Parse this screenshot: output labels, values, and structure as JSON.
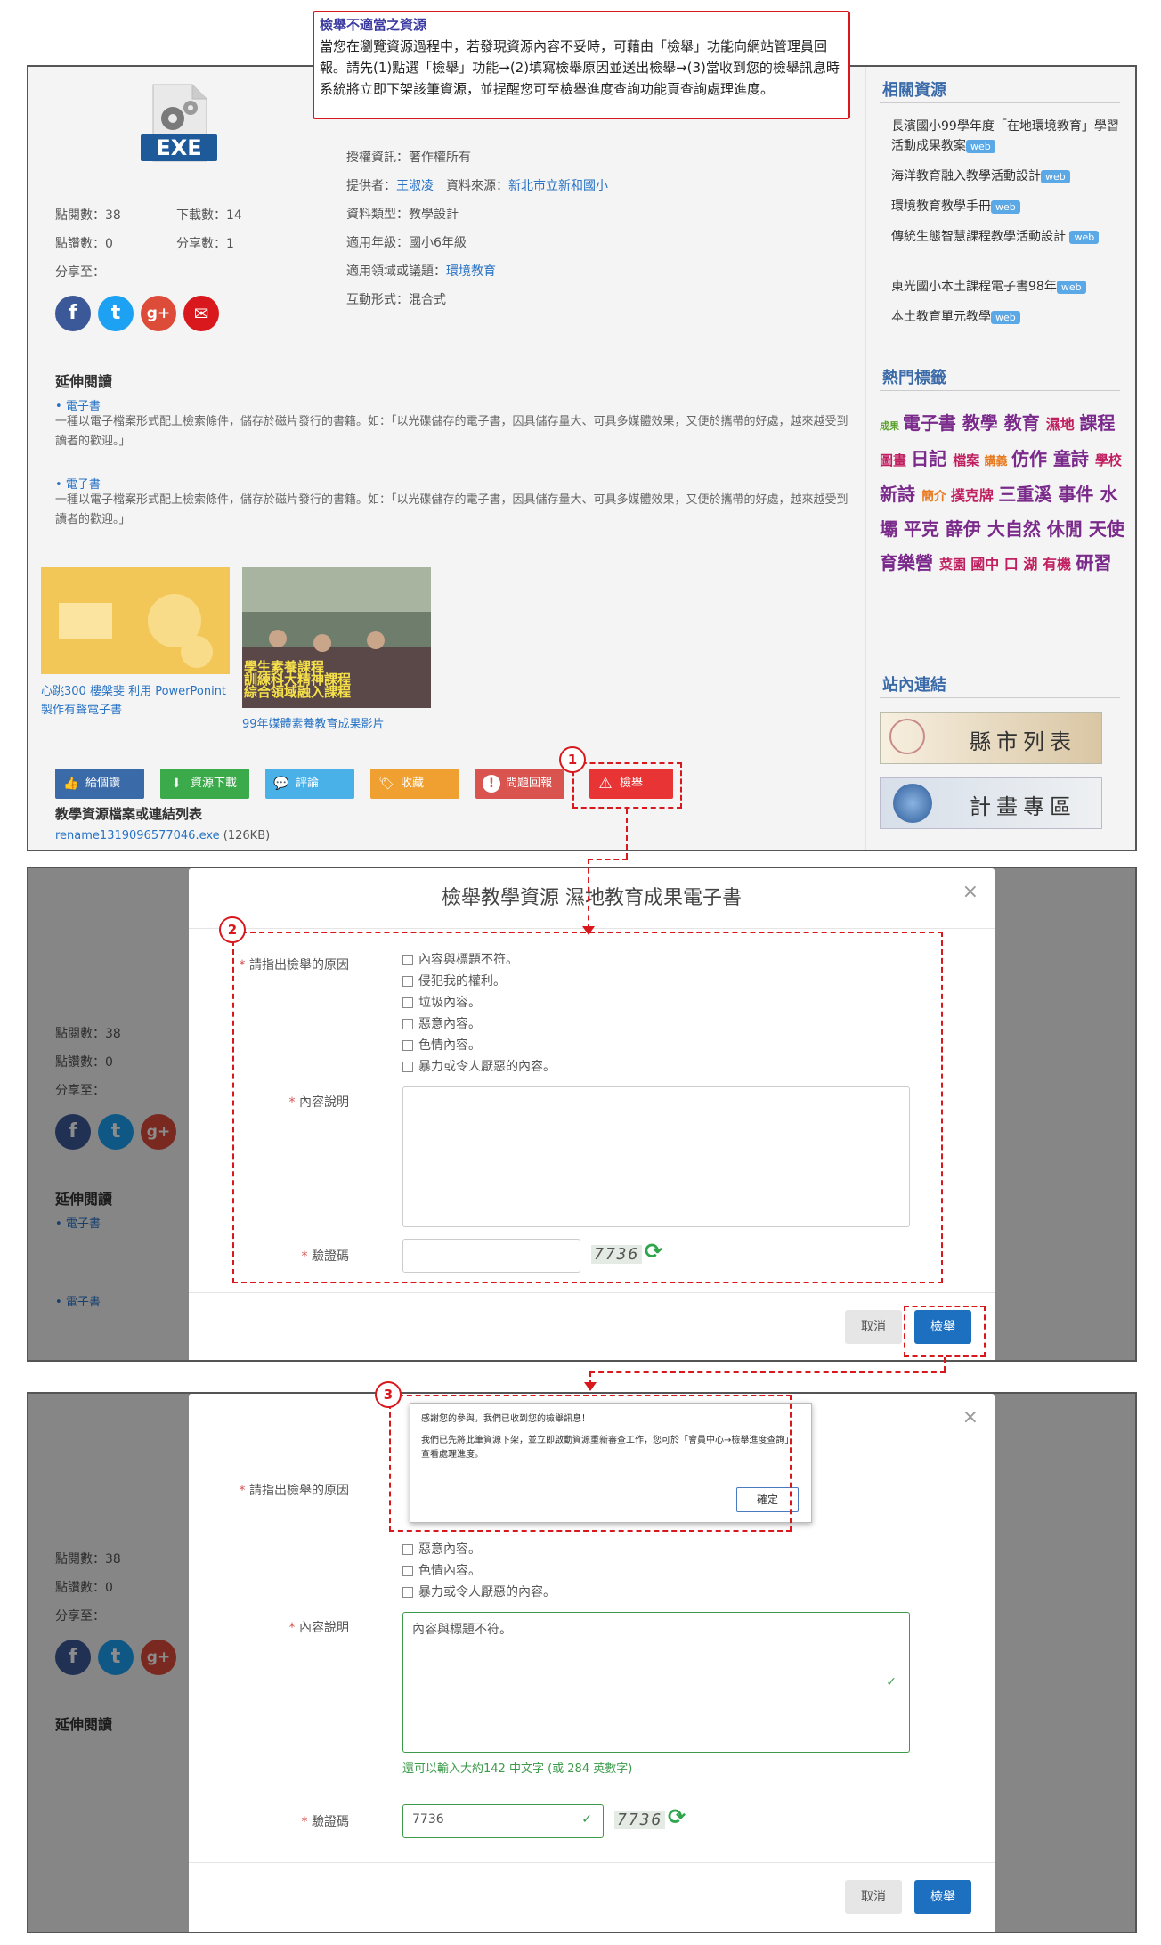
{
  "annotation": {
    "title": "檢舉不適當之資源",
    "body": "當您在瀏覽資源過程中，若發現資源內容不妥時，可藉由「檢舉」功能向網站管理員回報。請先(1)點選「檢舉」功能→(2)填寫檢舉原因並送出檢舉→(3)當收到您的檢舉訊息時系統將立即下架該筆資源，並提醒您可至檢舉進度查詢功能頁查詢處理進度。"
  },
  "file_icon": {
    "label": "EXE",
    "icon": "exe-file-icon"
  },
  "stats": {
    "views": "點閱數：38",
    "downloads": "下載數：14",
    "likes": "點讚數：0",
    "shares": "分享數：1",
    "share_to": "分享至："
  },
  "social": [
    {
      "name": "facebook-icon",
      "glyph": "f",
      "color": "#3b5998"
    },
    {
      "name": "twitter-icon",
      "glyph": "t",
      "color": "#1da1f2"
    },
    {
      "name": "google-plus-icon",
      "glyph": "g+",
      "color": "#dd4b39"
    },
    {
      "name": "email-icon",
      "glyph": "✉",
      "color": "#d8181c"
    }
  ],
  "meta": {
    "license": "授權資訊：著作權所有",
    "provider_label": "提供者：",
    "provider": "王淑凌",
    "source_label": "資料來源：",
    "source": "新北市立新和國小",
    "type": "資料類型：教學設計",
    "grade": "適用年級：國小6年級",
    "domain_label": "適用領域或議題：",
    "domain": "環境教育",
    "interaction": "互動形式：混合式"
  },
  "extended": {
    "title": "延伸閱讀",
    "items": [
      {
        "link": "電子書",
        "text": "一種以電子檔案形式配上檢索條件，儲存於磁片發行的書籍。如：「以光碟儲存的電子書，因具儲存量大、可具多媒體效果，又便於攜帶的好處，越來越受到讀者的歡迎。」"
      },
      {
        "link": "電子書",
        "text": "一種以電子檔案形式配上檢索條件，儲存於磁片發行的書籍。如：「以光碟儲存的電子書，因具儲存量大、可具多媒體效果，又便於攜帶的好處，越來越受到讀者的歡迎。」"
      }
    ]
  },
  "thumbs": [
    {
      "caption": "心跳300 樓槃斐 利用 PowerPonint製作有聲電子書"
    },
    {
      "caption": "99年媒體素養教育成果影片",
      "overlay": "學生素養課程\n訓練科大精神課程\n綜合領域融入課程"
    }
  ],
  "actions": [
    {
      "label": "給個讚",
      "icon": "thumb-up-icon",
      "glyph": "👍",
      "color": "#3a6aa8"
    },
    {
      "label": "資源下載",
      "icon": "download-icon",
      "glyph": "⬇",
      "color": "#3aaa4a"
    },
    {
      "label": "評論",
      "icon": "comment-icon",
      "glyph": "💬",
      "color": "#4ab0e8"
    },
    {
      "label": "收藏",
      "icon": "tag-icon",
      "glyph": "🏷",
      "color": "#f0a030"
    },
    {
      "label": "問題回報",
      "icon": "alert-circle-icon",
      "glyph": "!",
      "color": "#d9534f"
    },
    {
      "label": "檢舉",
      "icon": "warning-icon",
      "glyph": "⚠",
      "color": "#e83434"
    }
  ],
  "files": {
    "title": "教學資源檔案或連結列表",
    "filename": "rename1319096577046.exe",
    "size": "(126KB)"
  },
  "related": {
    "title": "相關資源",
    "items": [
      "長濱國小99學年度「在地環境教育」學習活動成果教案",
      "海洋教育融入教學活動設計",
      "環境教育教學手冊",
      "傳統生態智慧課程教學活動設計",
      "東光國小本土課程電子書98年",
      "本土教育單元教學"
    ],
    "badge": "web"
  },
  "hot_tags": {
    "title": "熱門標籤",
    "tags": [
      {
        "t": "成果",
        "c": "#5aa02c",
        "s": 11
      },
      {
        "t": "電子書",
        "c": "#7a2a8a",
        "s": 20
      },
      {
        "t": "教學",
        "c": "#7a2a8a",
        "s": 20
      },
      {
        "t": "教育",
        "c": "#7a2a8a",
        "s": 20
      },
      {
        "t": "濕地",
        "c": "#c02060",
        "s": 16
      },
      {
        "t": "課程",
        "c": "#7a2a8a",
        "s": 20
      },
      {
        "t": "圖畫",
        "c": "#c02060",
        "s": 15
      },
      {
        "t": "日記",
        "c": "#7a2a8a",
        "s": 20
      },
      {
        "t": "檔案",
        "c": "#c02060",
        "s": 15
      },
      {
        "t": "講義",
        "c": "#e87a20",
        "s": 13
      },
      {
        "t": "仿作",
        "c": "#7a2a8a",
        "s": 20
      },
      {
        "t": "童詩",
        "c": "#7a2a8a",
        "s": 20
      },
      {
        "t": "學校",
        "c": "#c02060",
        "s": 15
      },
      {
        "t": "新詩",
        "c": "#7a2a8a",
        "s": 20
      },
      {
        "t": "簡介",
        "c": "#e87a20",
        "s": 14
      },
      {
        "t": "撲克牌",
        "c": "#c02060",
        "s": 16
      },
      {
        "t": "三重溪",
        "c": "#7a2a8a",
        "s": 20
      },
      {
        "t": "事件",
        "c": "#7a2a8a",
        "s": 20
      },
      {
        "t": "水壩",
        "c": "#7a2a8a",
        "s": 20
      },
      {
        "t": "平克",
        "c": "#7a2a8a",
        "s": 20
      },
      {
        "t": "薛伊",
        "c": "#7a2a8a",
        "s": 20
      },
      {
        "t": "大自然",
        "c": "#7a2a8a",
        "s": 20
      },
      {
        "t": "休閒",
        "c": "#7a2a8a",
        "s": 20
      },
      {
        "t": "天使",
        "c": "#7a2a8a",
        "s": 20
      },
      {
        "t": "育樂營",
        "c": "#7a2a8a",
        "s": 20
      },
      {
        "t": "菜園",
        "c": "#c02060",
        "s": 15
      },
      {
        "t": "國中",
        "c": "#c02060",
        "s": 16
      },
      {
        "t": "口",
        "c": "#c02060",
        "s": 16
      },
      {
        "t": "湖",
        "c": "#c02060",
        "s": 16
      },
      {
        "t": "有機",
        "c": "#c02060",
        "s": 16
      },
      {
        "t": "研習",
        "c": "#7a2a8a",
        "s": 20
      }
    ]
  },
  "site_links": {
    "title": "站內連結",
    "banners": [
      "縣市列表",
      "計畫專區"
    ]
  },
  "report_modal": {
    "title": "檢舉教學資源 濕地教育成果電子書",
    "reason_label": "請指出檢舉的原因",
    "reasons": [
      "內容與標題不符。",
      "侵犯我的權利。",
      "垃圾內容。",
      "惡意內容。",
      "色情內容。",
      "暴力或令人厭惡的內容。"
    ],
    "content_label": "內容說明",
    "content_value": "內容與標題不符。",
    "captcha_label": "驗證碼",
    "captcha_value": "7736",
    "captcha_image": "7736",
    "hint": "還可以輸入大約142 中文字 (或 284 英數字)",
    "cancel": "取消",
    "submit": "檢舉"
  },
  "confirm": {
    "line1": "感謝您的參與，我們已收到您的檢舉訊息！",
    "line2": "我們已先將此筆資源下架，並立即啟動資源重新審查工作，您可於「會員中心→檢舉進度查詢」查看處理進度。",
    "ok": "確定"
  },
  "markers": [
    "1",
    "2",
    "3"
  ]
}
